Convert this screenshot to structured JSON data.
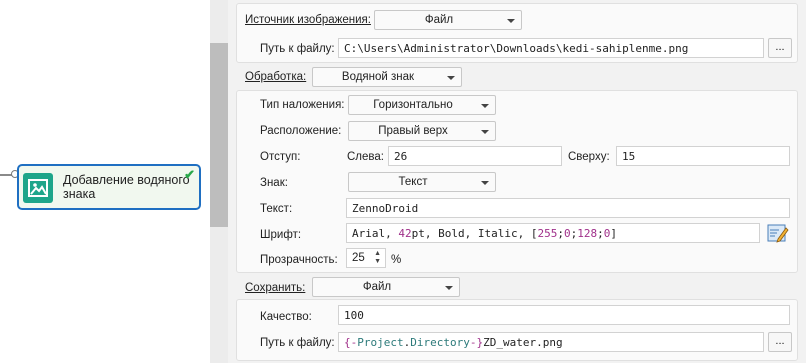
{
  "node": {
    "title": "Добавление водяного знака"
  },
  "image_source": {
    "label": "Источник изображения:",
    "value": "Файл"
  },
  "file_path_in": {
    "label": "Путь к файлу:",
    "value": "C:\\Users\\Administrator\\Downloads\\kedi-sahiplenme.png",
    "browse": "..."
  },
  "processing": {
    "label": "Обработка:",
    "value": "Водяной знак"
  },
  "overlay_type": {
    "label": "Тип наложения:",
    "value": "Горизонтально"
  },
  "position": {
    "label": "Расположение:",
    "value": "Правый верх"
  },
  "offset": {
    "label": "Отступ:",
    "left_label": "Слева:",
    "left_value": "26",
    "top_label": "Сверху:",
    "top_value": "15"
  },
  "mark": {
    "label": "Знак:",
    "value": "Текст"
  },
  "text": {
    "label": "Текст:",
    "value": "ZennoDroid"
  },
  "font": {
    "label": "Шрифт:",
    "parts": {
      "name": "Arial, ",
      "size_num": "42",
      "size_unit": "pt, Bold, Italic, [",
      "r": "255",
      "sep1": ";",
      "g": "0",
      "sep2": ";",
      "b": "128",
      "sep3": ";",
      "a": "0",
      "end": "]"
    }
  },
  "opacity": {
    "label": "Прозрачность:",
    "value": "25",
    "unit": "%"
  },
  "save": {
    "label": "Сохранить:",
    "value": "Файл"
  },
  "quality": {
    "label": "Качество:",
    "value": "100"
  },
  "file_path_out": {
    "label": "Путь к файлу:",
    "parts": {
      "open": "{-",
      "project": "Project",
      "dot": ".",
      "directory": "Directory",
      "close": "-}",
      "name": "ZD_water.png"
    },
    "browse": "..."
  },
  "colors": {
    "node_border": "#1f6fc2",
    "node_icon": "#1ea58a",
    "check": "#2aa84a",
    "number": "#a0308a",
    "variable": "#2c7a7a"
  }
}
